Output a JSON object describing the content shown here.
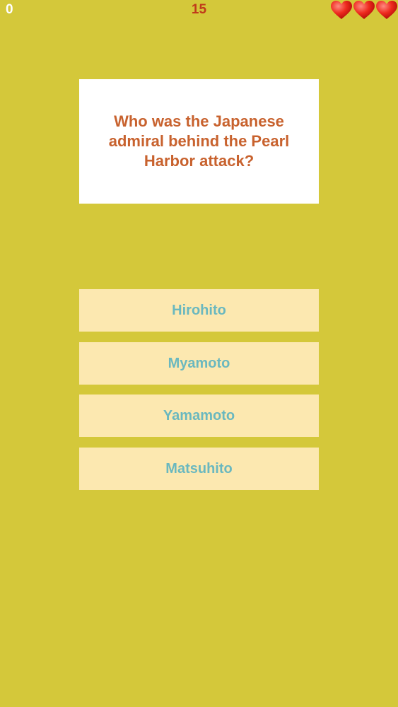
{
  "hud": {
    "score": "0",
    "timer": "15",
    "lives": 3,
    "heart_color": "#e8231c"
  },
  "question": {
    "text": "Who was the Japanese admiral behind the Pearl Harbor attack?"
  },
  "answers": [
    {
      "label": "Hirohito"
    },
    {
      "label": "Myamoto"
    },
    {
      "label": "Yamamoto"
    },
    {
      "label": "Matsuhito"
    }
  ],
  "colors": {
    "background": "#d4c83a",
    "question_text": "#c8622e",
    "answer_bg": "#fce8b0",
    "answer_text": "#6ab8bf",
    "timer_text": "#c03a1a"
  }
}
